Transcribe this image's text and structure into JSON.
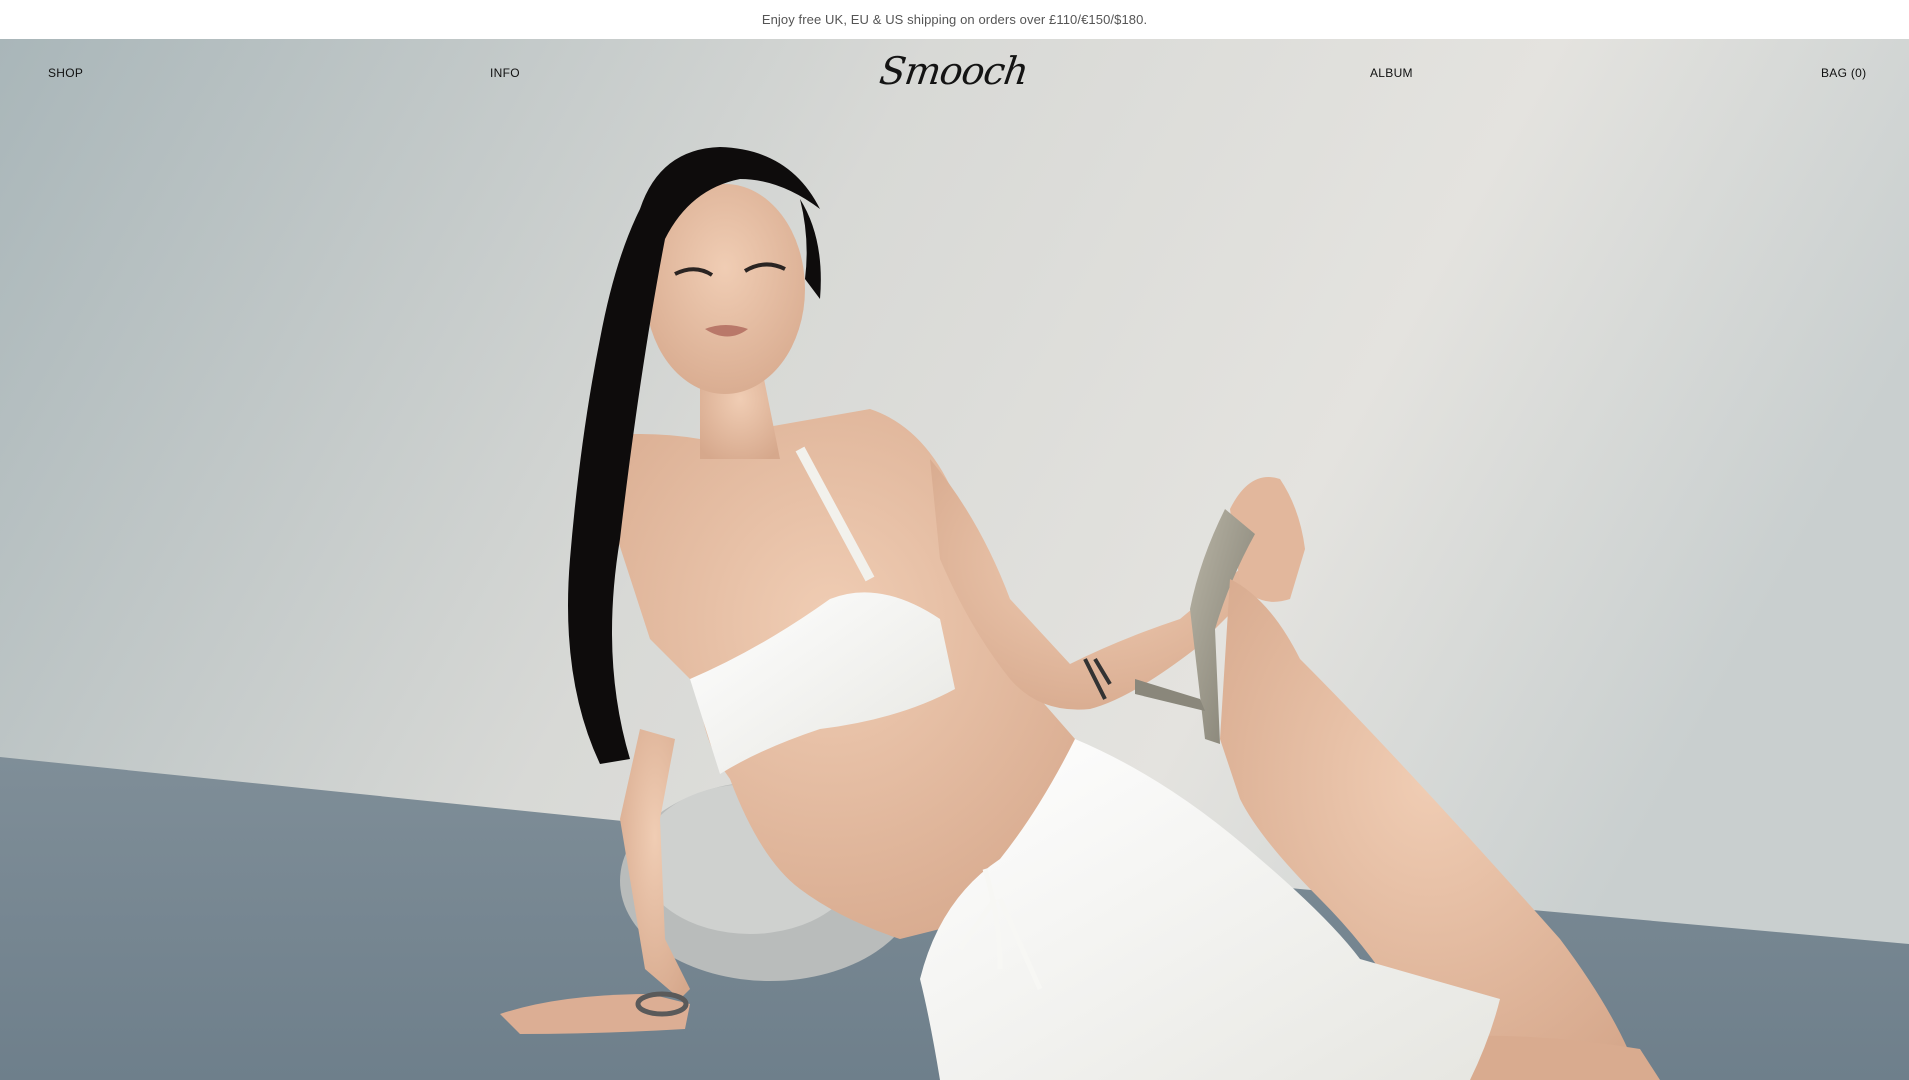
{
  "announcement": {
    "text": "Enjoy free UK, EU & US shipping on orders over £110/€150/$180."
  },
  "nav": {
    "shop": "SHOP",
    "info": "INFO",
    "logo": "Smooch",
    "album": "ALBUM",
    "bag": "BAG (0)"
  },
  "hero": {
    "image_description": "",
    "colors": {
      "wall": "#d9dad8",
      "floor": "#7b8a94",
      "garment": "#f4f3ee",
      "hair": "#0d0b0b",
      "skin": "#e8bfa4"
    }
  }
}
